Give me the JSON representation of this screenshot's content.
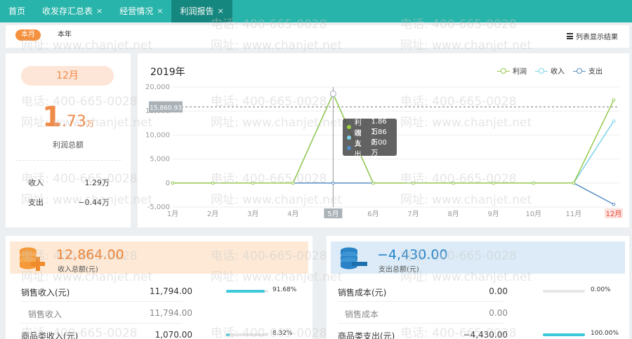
{
  "tabs": [
    {
      "label": "首页",
      "closable": false
    },
    {
      "label": "收发存汇总表",
      "closable": true
    },
    {
      "label": "经营情况",
      "closable": true
    },
    {
      "label": "利润报告",
      "closable": true,
      "active": true
    }
  ],
  "close_glyph": "×",
  "period": {
    "current": "本月",
    "other": "本年",
    "list_button": "列表显示结果"
  },
  "summary": {
    "month": "12月",
    "profit_int": "1",
    "profit_dec": ".73",
    "profit_unit": "万",
    "profit_label": "利润总额",
    "income_label": "收入",
    "income_value": "1.29万",
    "expense_label": "支出",
    "expense_value": "−0.44万"
  },
  "chart_data": {
    "type": "line",
    "title": "2019年",
    "categories": [
      "1月",
      "2月",
      "3月",
      "4月",
      "5月",
      "6月",
      "7月",
      "8月",
      "9月",
      "10月",
      "11月",
      "12月"
    ],
    "series": [
      {
        "name": "利润",
        "color": "#96c84c",
        "values": [
          0,
          0,
          0,
          0,
          18600,
          0,
          0,
          0,
          0,
          0,
          0,
          17300
        ]
      },
      {
        "name": "收入",
        "color": "#7fd3ea",
        "values": [
          0,
          0,
          0,
          0,
          18600,
          0,
          0,
          0,
          0,
          0,
          0,
          12900
        ]
      },
      {
        "name": "支出",
        "color": "#5a8fc4",
        "values": [
          0,
          0,
          0,
          0,
          0,
          0,
          0,
          0,
          0,
          0,
          0,
          -4430
        ]
      }
    ],
    "y_ticks": [
      "20,000",
      "15,000",
      "10,000",
      "5,000",
      "0",
      "-5,000"
    ],
    "y_tick_values": [
      20000,
      15000,
      10000,
      5000,
      0,
      -5000
    ],
    "ylim": [
      -5000,
      20000
    ],
    "reference_label": "15,860.93",
    "reference_value": 15860.93,
    "highlight_x": "5月",
    "highlight_x_last": "12月",
    "legend_position": "top-right",
    "grid": true
  },
  "tooltip": {
    "rows": [
      {
        "label": "利润",
        "value": "1.86万",
        "color": "#9ccf3c"
      },
      {
        "label": "收入",
        "value": "1.86万",
        "color": "#7fd3ea"
      },
      {
        "label": "支出",
        "value": "0.00万",
        "color": "#4f8bc9"
      }
    ]
  },
  "income_card": {
    "amount": "12,864.00",
    "label": "收入总额(元)",
    "rows": [
      {
        "name": "销售收入(元)",
        "value": "11,794.00",
        "pct": "91.68%",
        "fill": 0.9168
      },
      {
        "name": "销售收入",
        "value": "11,794.00",
        "sub": true
      },
      {
        "name": "商品类收入(元)",
        "value": "1,070.00",
        "pct": "8.32%",
        "fill": 0.0832
      }
    ]
  },
  "expense_card": {
    "amount": "−4,430.00",
    "label": "支出总额(元)",
    "rows": [
      {
        "name": "销售成本(元)",
        "value": "0.00",
        "pct": "0.00%",
        "fill": 0
      },
      {
        "name": "销售成本",
        "value": "0.00",
        "sub": true
      },
      {
        "name": "商品类支出(元)",
        "value": "−4,430.00",
        "pct": "100.00%",
        "fill": 1
      }
    ]
  },
  "watermark": {
    "phone": "电话: 400-665-0028",
    "site": "网址: www.chanjet.net"
  },
  "colors": {
    "teal": "#28b4aa",
    "teal_active": "#16877f",
    "orange": "#f08a47",
    "blue": "#2283cb",
    "bar": "#3dc8db"
  }
}
